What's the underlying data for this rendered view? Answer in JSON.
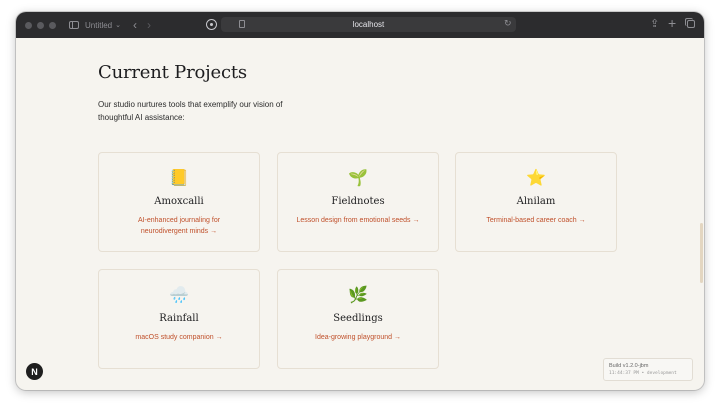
{
  "browser": {
    "tab_title": "Untitled",
    "url": "localhost"
  },
  "main": {
    "title": "Current Projects",
    "intro": "Our studio nurtures tools that exemplify our vision of thoughtful AI assistance:",
    "projects": [
      {
        "icon": "notebook-icon",
        "emoji": "📒",
        "name": "Amoxcalli",
        "description": "AI-enhanced journaling for neurodivergent minds →"
      },
      {
        "icon": "seedling-icon",
        "emoji": "🌱",
        "name": "Fieldnotes",
        "description": "Lesson design from emotional seeds →"
      },
      {
        "icon": "star-icon",
        "emoji": "⭐",
        "name": "Alnilam",
        "description": "Terminal-based career coach →"
      },
      {
        "icon": "rain-cloud-icon",
        "emoji": "🌧️",
        "name": "Rainfall",
        "description": "macOS study companion →"
      },
      {
        "icon": "herb-icon",
        "emoji": "🌿",
        "name": "Seedlings",
        "description": "Idea-growing playground →"
      }
    ]
  },
  "dev_overlay": {
    "badge": "N",
    "build": "Build v1.2.0-jbm",
    "meta": "11:44:37 PM • development"
  },
  "colors": {
    "accent": "#c0502b",
    "page_background": "#f6f4ef",
    "card_border": "#e6dfd3"
  }
}
